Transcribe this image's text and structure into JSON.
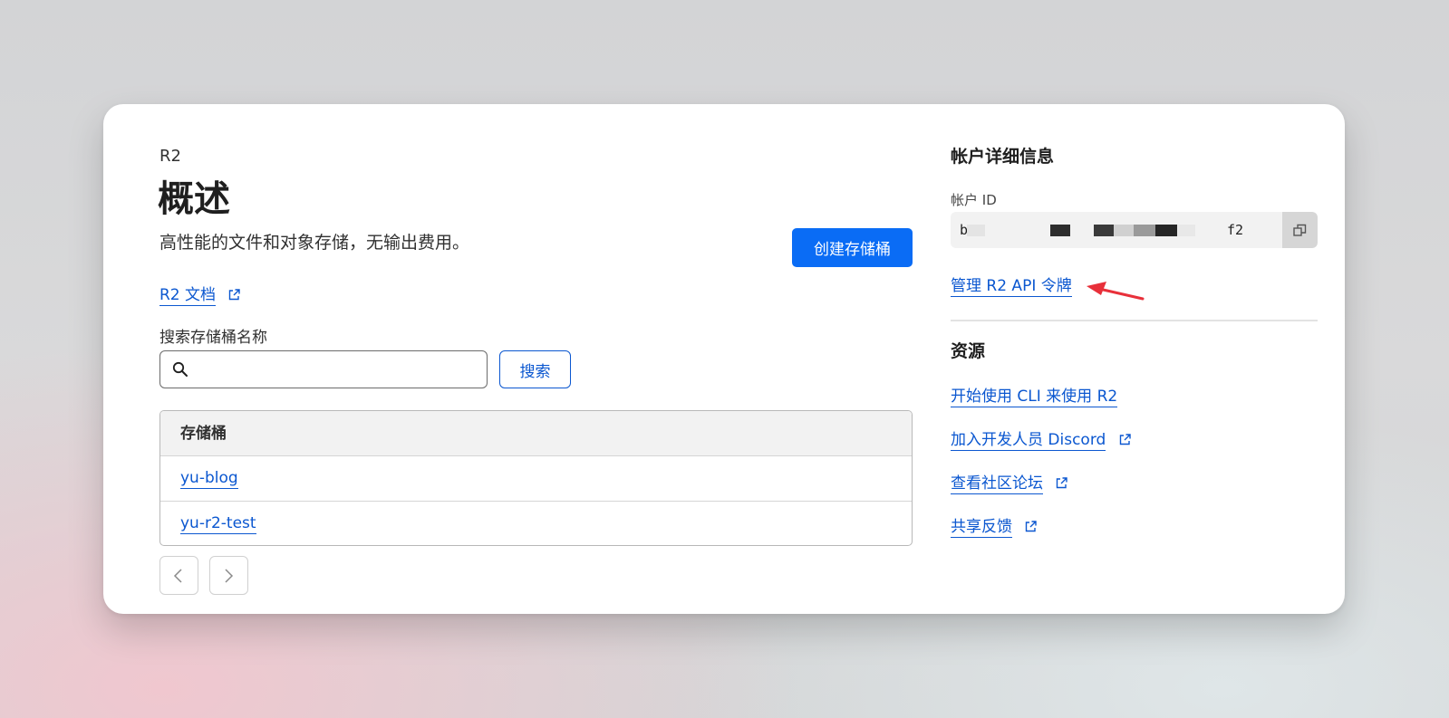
{
  "header": {
    "breadcrumb": "R2",
    "title": "概述",
    "subtitle": "高性能的文件和对象存储，无输出费用。",
    "create_button": "创建存储桶",
    "docs_link": "R2 文档"
  },
  "search": {
    "label": "搜索存储桶名称",
    "value": "",
    "placeholder": "",
    "button": "搜索"
  },
  "table": {
    "header": "存储桶",
    "rows": [
      "yu-blog",
      "yu-r2-test"
    ]
  },
  "account": {
    "heading": "帐户详细信息",
    "id_label": "帐户 ID",
    "id_prefix": "b",
    "id_suffix": "f2",
    "manage_tokens_link": "管理 R2 API 令牌"
  },
  "resources": {
    "heading": "资源",
    "links": [
      "开始使用 CLI 来使用 R2",
      "加入开发人员 Discord",
      "查看社区论坛",
      "共享反馈"
    ]
  },
  "colors": {
    "primary": "#0a6cf5",
    "link": "#0b57d0",
    "annotation_arrow": "#e8303a"
  },
  "icons": [
    "search-icon",
    "external-link-icon",
    "copy-icon",
    "chevron-left-icon",
    "chevron-right-icon",
    "annotation-arrow-icon"
  ]
}
